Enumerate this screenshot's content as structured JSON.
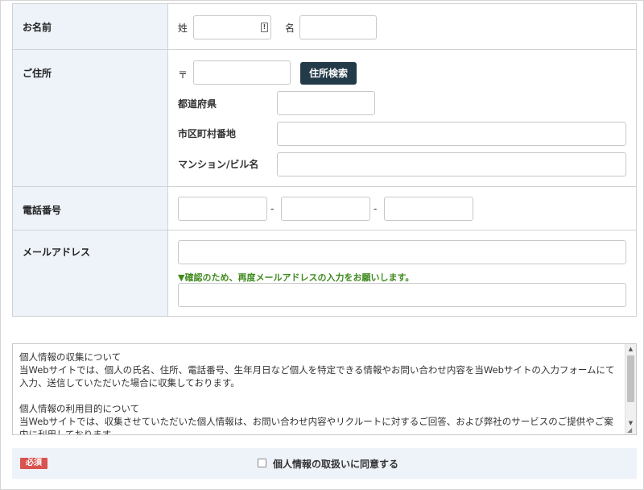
{
  "form": {
    "name": {
      "label": "お名前",
      "last_label": "姓",
      "first_label": "名",
      "last_value": "",
      "first_value": ""
    },
    "address": {
      "label": "ご住所",
      "postal_mark": "〒",
      "postal_value": "",
      "search_button": "住所検索",
      "prefecture_label": "都道府県",
      "city_label": "市区町村番地",
      "building_label": "マンション/ビル名",
      "prefecture_value": "",
      "city_value": "",
      "building_value": ""
    },
    "phone": {
      "label": "電話番号",
      "separator": "-",
      "part1": "",
      "part2": "",
      "part3": ""
    },
    "email": {
      "label": "メールアドレス",
      "value": "",
      "confirm_hint": "▼確認のため、再度メールアドレスの入力をお願いします。",
      "confirm_value": ""
    }
  },
  "policy": {
    "sections": [
      {
        "heading": "個人情報の収集について",
        "body": "当Webサイトでは、個人の氏名、住所、電話番号、生年月日など個人を特定できる情報やお問い合わせ内容を当Webサイトの入力フォームにて入力、送信していただいた場合に収集しております。"
      },
      {
        "heading": "個人情報の利用目的について",
        "body": "当Webサイトでは、収集させていただいた個人情報は、お問い合わせ内容やリクルートに対するご回答、および弊社のサービスのご提供やご案内に利用しております。"
      }
    ]
  },
  "agreement": {
    "required_badge": "必須",
    "label": "個人情報の取扱いに同意する",
    "checked": false
  },
  "colors": {
    "label_bg": "#eef3fa",
    "button_bg": "#233a48",
    "hint_green": "#3f8a1e",
    "required_red": "#d9534f"
  }
}
